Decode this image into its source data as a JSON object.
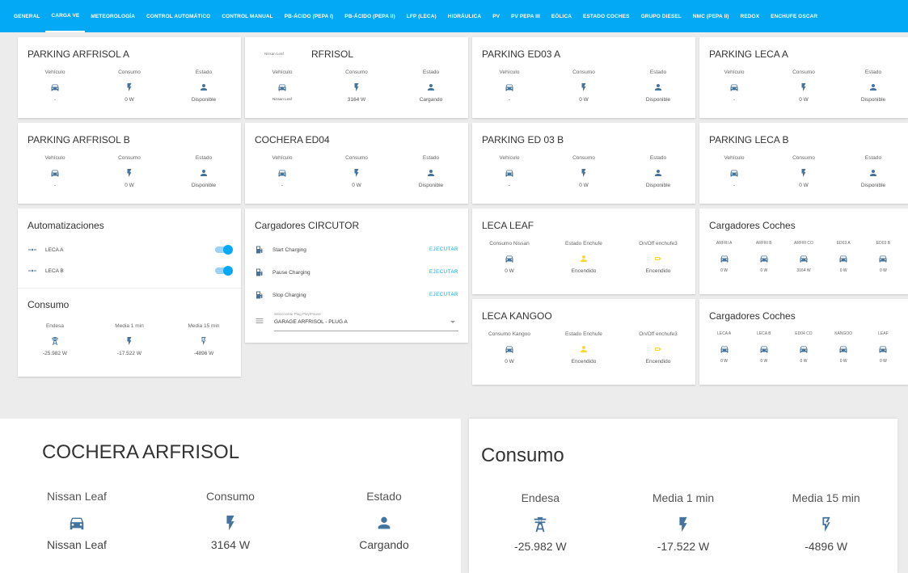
{
  "tabs": [
    "GENERAL",
    "CARGA VE",
    "METEOROLOGÍA",
    "CONTROL AUTOMÁTICO",
    "CONTROL MANUAL",
    "PB-ÁCIDO (PEPA I)",
    "PB-ÁCIDO (PEPA II)",
    "LFP (LECA)",
    "HIDRÁULICA",
    "PV",
    "PV PEPA III",
    "EÓLICA",
    "ESTADO COCHES",
    "GRUPO DIESEL",
    "NMC (PEPA II)",
    "REDOX",
    "ENCHUFE OSCAR"
  ],
  "active_tab": "CARGA VE",
  "colors": {
    "accent": "#03a9f4",
    "icon": "#44739e",
    "icon_on": "#fdd835"
  },
  "parking_arfrisol_a": {
    "title": "PARKING ARFRISOL A",
    "h1": "Vehículo",
    "h2": "Consumo",
    "h3": "Estado",
    "v1": "-",
    "v2": "0 W",
    "v3": "Disponible"
  },
  "cochera_arfrisol": {
    "title": "RFRISOL",
    "overlay_label": "Nissan Leaf",
    "h1": "Vehículo",
    "h2": "Consumo",
    "h3": "Estado",
    "v1": "Nissan Leaf",
    "v2": "3164 W",
    "v3": "Cargando"
  },
  "parking_ed03_a": {
    "title": "PARKING ED03 A",
    "h1": "Vehículo",
    "h2": "Consumo",
    "h3": "Estado",
    "v1": "-",
    "v2": "0 W",
    "v3": "Disponible"
  },
  "parking_leca_a": {
    "title": "PARKING LECA A",
    "h1": "Vehículo",
    "h2": "Consumo",
    "h3": "Estado",
    "v1": "-",
    "v2": "0 W",
    "v3": "Disponible"
  },
  "parking_arfrisol_b": {
    "title": "PARKING ARFRISOL B",
    "h1": "Vehículo",
    "h2": "Consumo",
    "h3": "Estado",
    "v1": "-",
    "v2": "0 W",
    "v3": "Disponible"
  },
  "cochera_ed04": {
    "title": "COCHERA ED04",
    "h1": "Vehículo",
    "h2": "Consumo",
    "h3": "Estado",
    "v1": "-",
    "v2": "0 W",
    "v3": "Disponible"
  },
  "parking_ed03_b": {
    "title": "PARKING ED 03 B",
    "h1": "Vehículo",
    "h2": "Consumo",
    "h3": "Estado",
    "v1": "-",
    "v2": "0 W",
    "v3": "Disponible"
  },
  "parking_leca_b": {
    "title": "PARKING LECA B",
    "h1": "Vehículo",
    "h2": "Consumo",
    "h3": "Estado",
    "v1": "-",
    "v2": "0 W",
    "v3": "Disponible"
  },
  "automatizaciones": {
    "title": "Automatizaciones",
    "items": [
      "LECA A",
      "LECA B"
    ],
    "states": [
      true,
      true
    ]
  },
  "consumo": {
    "title": "Consumo",
    "h1": "Endesa",
    "h2": "Media 1 min",
    "h3": "Media 15 min",
    "v1": "-25.982 W",
    "v2": "-17.522 W",
    "v3": "-4896 W"
  },
  "circutor": {
    "title": "Cargadores CIRCUTOR",
    "scripts": [
      "Start Charging",
      "Pause Charging",
      "Stop Charging"
    ],
    "exec_label": "EJECUTAR",
    "select_label": "Seleccionar Plug Play/Pause",
    "select_value": "GARAGE ARFRISOL - PLUG A"
  },
  "leca_leaf": {
    "title": "LECA LEAF",
    "h1": "Consumo Nissan",
    "h2": "Estado Enchufe",
    "h3": "On/Off enchufe3",
    "v1": "0 W",
    "v2": "Encendido",
    "v3": "Encendido"
  },
  "leca_kangoo": {
    "title": "LECA KANGOO",
    "h1": "Consumo Kangoo",
    "h2": "Estado Enchufe",
    "h3": "On/Off enchufe3",
    "v1": "0 W",
    "v2": "Encendido",
    "v3": "Encendido"
  },
  "cargadores_coches_1": {
    "title": "Cargadores Coches",
    "labels": [
      "ARFRI A",
      "ARFRI B",
      "ARFRI CO",
      "ED03 A",
      "ED03 B"
    ],
    "values": [
      "0 W",
      "0 W",
      "3164 W",
      "0 W",
      "0 W"
    ]
  },
  "cargadores_coches_2": {
    "title": "Cargadores Coches",
    "labels": [
      "LECA A",
      "LECA B",
      "ED04 CO",
      "KANGOO",
      "LEAF"
    ],
    "values": [
      "0 W",
      "0 W",
      "0 W",
      "0 W",
      "0 W"
    ]
  },
  "zoom_cochera": {
    "title": "COCHERA ARFRISOL",
    "h1": "Nissan Leaf",
    "h2": "Consumo",
    "h3": "Estado",
    "v1": "Nissan Leaf",
    "v2": "3164 W",
    "v3": "Cargando"
  },
  "zoom_consumo": {
    "title": "Consumo",
    "h1": "Endesa",
    "h2": "Media 1 min",
    "h3": "Media 15 min",
    "v1": "-25.982 W",
    "v2": "-17.522 W",
    "v3": "-4896 W"
  }
}
